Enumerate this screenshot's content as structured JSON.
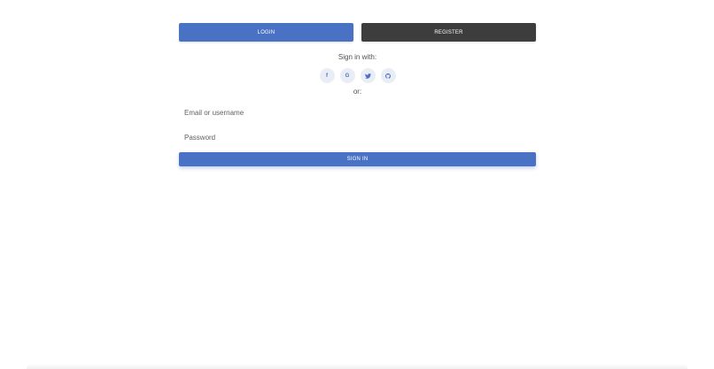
{
  "tabs": {
    "login_label": "LOGIN",
    "register_label": "REGISTER"
  },
  "social": {
    "heading": "Sign in with:",
    "buttons": [
      {
        "icon": "facebook-icon",
        "glyph": "f"
      },
      {
        "icon": "google-icon",
        "glyph": "G"
      },
      {
        "icon": "twitter-icon",
        "glyph": ""
      },
      {
        "icon": "github-icon",
        "glyph": ""
      }
    ]
  },
  "divider_text": "or:",
  "form": {
    "email_placeholder": "Email or username",
    "email_value": "",
    "password_placeholder": "Password",
    "password_value": "",
    "submit_label": "SIGN IN"
  },
  "colors": {
    "primary": "#4a72c4",
    "dark": "#3d3d3d",
    "social_bg": "#e9edf6",
    "text": "#4f4f4f"
  }
}
